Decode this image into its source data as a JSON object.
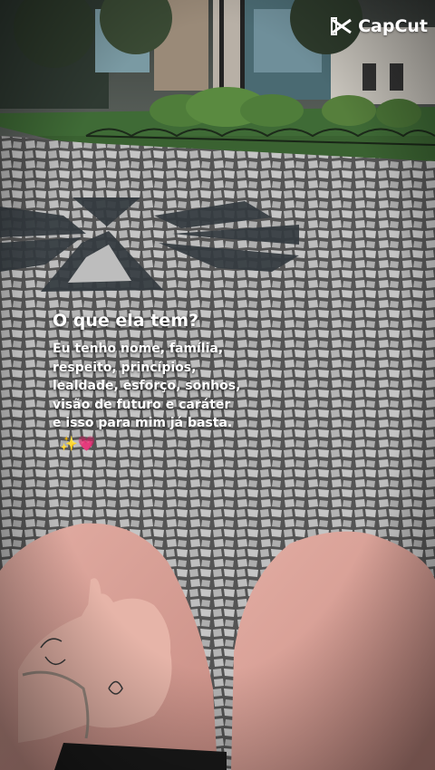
{
  "watermark": {
    "brand": "CapCut",
    "icon": "capcut-logo-icon"
  },
  "caption": {
    "title": "O que ela tem?",
    "lines": [
      "Eu tenho nome, família,",
      "respeito, princípios,",
      "lealdade, esforço, sonhos,",
      "visão de futuro e caráter",
      "e isso para mim já basta."
    ],
    "emoji": "✨💗"
  },
  "scene": {
    "description_icons": [
      "park-trees",
      "hedge",
      "mosaic-pavement",
      "knees",
      "hand-with-tattoo",
      "bracelet"
    ]
  }
}
